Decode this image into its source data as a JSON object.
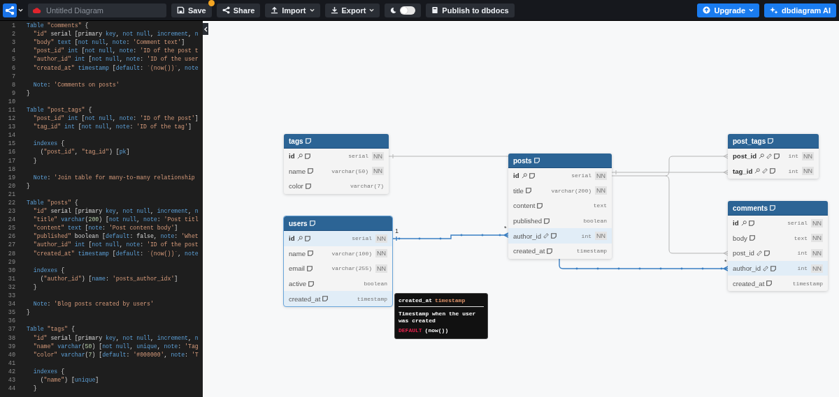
{
  "top_bar": {
    "title_field": {
      "value": "Untitled Diagram"
    },
    "buttons": [
      {
        "kind": "save",
        "label": "Save",
        "unsaved": true
      },
      {
        "kind": "share",
        "label": "Share"
      },
      {
        "kind": "import",
        "label": "Import",
        "dropdown": true
      },
      {
        "kind": "export",
        "label": "Export",
        "dropdown": true
      },
      {
        "kind": "theme",
        "on": false
      },
      {
        "kind": "publish",
        "label": "Publish to dbdocs"
      }
    ],
    "right_buttons": [
      {
        "kind": "upgrade",
        "label": "Upgrade",
        "dropdown": true
      },
      {
        "kind": "ai",
        "label": "dbdiagram AI"
      }
    ]
  },
  "editor": {
    "lines": [
      {
        "n": "1",
        "code": [
          {
            "kind": "kw",
            "text": "Table "
          },
          {
            "kind": "str",
            "text": "\"comments\""
          },
          {
            "kind": "plain",
            "text": " {"
          }
        ]
      },
      {
        "n": "2",
        "code": [
          {
            "kind": "str",
            "text": "  \"id\""
          },
          {
            "kind": "plain",
            "text": " serial [primary "
          },
          {
            "kind": "kw",
            "text": "key"
          },
          {
            "kind": "plain",
            "text": ", "
          },
          {
            "kind": "kw",
            "text": "not null"
          },
          {
            "kind": "plain",
            "text": ", "
          },
          {
            "kind": "kw",
            "text": "increment"
          },
          {
            "kind": "plain",
            "text": ", "
          },
          {
            "kind": "kw",
            "text": "n"
          }
        ]
      },
      {
        "n": "3",
        "code": [
          {
            "kind": "str",
            "text": "  \"body\""
          },
          {
            "kind": "kw",
            "text": " text"
          },
          {
            "kind": "plain",
            "text": " ["
          },
          {
            "kind": "kw",
            "text": "not null"
          },
          {
            "kind": "plain",
            "text": ", "
          },
          {
            "kind": "kw",
            "text": "note"
          },
          {
            "kind": "plain",
            "text": ": "
          },
          {
            "kind": "str",
            "text": "'Comment text'"
          },
          {
            "kind": "plain",
            "text": "]"
          }
        ]
      },
      {
        "n": "4",
        "code": [
          {
            "kind": "str",
            "text": "  \"post_id\""
          },
          {
            "kind": "kw",
            "text": " int"
          },
          {
            "kind": "plain",
            "text": " ["
          },
          {
            "kind": "kw",
            "text": "not null"
          },
          {
            "kind": "plain",
            "text": ", "
          },
          {
            "kind": "kw",
            "text": "note"
          },
          {
            "kind": "plain",
            "text": ": "
          },
          {
            "kind": "str",
            "text": "'ID of the post t"
          }
        ]
      },
      {
        "n": "5",
        "code": [
          {
            "kind": "str",
            "text": "  \"author_id\""
          },
          {
            "kind": "kw",
            "text": " int"
          },
          {
            "kind": "plain",
            "text": " ["
          },
          {
            "kind": "kw",
            "text": "not null"
          },
          {
            "kind": "plain",
            "text": ", "
          },
          {
            "kind": "kw",
            "text": "note"
          },
          {
            "kind": "plain",
            "text": ": "
          },
          {
            "kind": "str",
            "text": "'ID of the user"
          }
        ]
      },
      {
        "n": "6",
        "code": [
          {
            "kind": "str",
            "text": "  \"created_at\""
          },
          {
            "kind": "kw",
            "text": " timestamp"
          },
          {
            "kind": "plain",
            "text": " ["
          },
          {
            "kind": "kw",
            "text": "default"
          },
          {
            "kind": "plain",
            "text": ": "
          },
          {
            "kind": "str",
            "text": "`(now())`"
          },
          {
            "kind": "plain",
            "text": ", "
          },
          {
            "kind": "kw",
            "text": "note"
          }
        ]
      },
      {
        "n": "7"
      },
      {
        "n": "8",
        "code": [
          {
            "kind": "kw",
            "text": "  Note"
          },
          {
            "kind": "plain",
            "text": ": "
          },
          {
            "kind": "str",
            "text": "'Comments on posts'"
          }
        ]
      },
      {
        "n": "9",
        "code": [
          {
            "kind": "plain",
            "text": "}"
          }
        ]
      },
      {
        "n": "10"
      },
      {
        "n": "11",
        "code": [
          {
            "kind": "kw",
            "text": "Table "
          },
          {
            "kind": "str",
            "text": "\"post_tags\""
          },
          {
            "kind": "plain",
            "text": " {"
          }
        ]
      },
      {
        "n": "12",
        "code": [
          {
            "kind": "str",
            "text": "  \"post_id\""
          },
          {
            "kind": "kw",
            "text": " int"
          },
          {
            "kind": "plain",
            "text": " ["
          },
          {
            "kind": "kw",
            "text": "not null"
          },
          {
            "kind": "plain",
            "text": ", "
          },
          {
            "kind": "kw",
            "text": "note"
          },
          {
            "kind": "plain",
            "text": ": "
          },
          {
            "kind": "str",
            "text": "'ID of the post'"
          },
          {
            "kind": "plain",
            "text": "]"
          }
        ]
      },
      {
        "n": "13",
        "code": [
          {
            "kind": "str",
            "text": "  \"tag_id\""
          },
          {
            "kind": "kw",
            "text": " int"
          },
          {
            "kind": "plain",
            "text": " ["
          },
          {
            "kind": "kw",
            "text": "not null"
          },
          {
            "kind": "plain",
            "text": ", "
          },
          {
            "kind": "kw",
            "text": "note"
          },
          {
            "kind": "plain",
            "text": ": "
          },
          {
            "kind": "str",
            "text": "'ID of the tag'"
          },
          {
            "kind": "plain",
            "text": "]"
          }
        ]
      },
      {
        "n": "14"
      },
      {
        "n": "15",
        "code": [
          {
            "kind": "kw",
            "text": "  indexes"
          },
          {
            "kind": "plain",
            "text": " {"
          }
        ]
      },
      {
        "n": "16",
        "code": [
          {
            "kind": "plain",
            "text": "    ("
          },
          {
            "kind": "str",
            "text": "\"post_id\""
          },
          {
            "kind": "plain",
            "text": ", "
          },
          {
            "kind": "str",
            "text": "\"tag_id\""
          },
          {
            "kind": "plain",
            "text": ") ["
          },
          {
            "kind": "kw",
            "text": "pk"
          },
          {
            "kind": "plain",
            "text": "]"
          }
        ]
      },
      {
        "n": "17",
        "code": [
          {
            "kind": "plain",
            "text": "  }"
          }
        ]
      },
      {
        "n": "18"
      },
      {
        "n": "19",
        "code": [
          {
            "kind": "kw",
            "text": "  Note"
          },
          {
            "kind": "plain",
            "text": ": "
          },
          {
            "kind": "str",
            "text": "'Join table for many-to-many relationship"
          }
        ]
      },
      {
        "n": "20",
        "code": [
          {
            "kind": "plain",
            "text": "}"
          }
        ]
      },
      {
        "n": "21"
      },
      {
        "n": "22",
        "code": [
          {
            "kind": "kw",
            "text": "Table "
          },
          {
            "kind": "str",
            "text": "\"posts\""
          },
          {
            "kind": "plain",
            "text": " {"
          }
        ]
      },
      {
        "n": "23",
        "code": [
          {
            "kind": "str",
            "text": "  \"id\""
          },
          {
            "kind": "plain",
            "text": " serial [primary "
          },
          {
            "kind": "kw",
            "text": "key"
          },
          {
            "kind": "plain",
            "text": ", "
          },
          {
            "kind": "kw",
            "text": "not null"
          },
          {
            "kind": "plain",
            "text": ", "
          },
          {
            "kind": "kw",
            "text": "increment"
          },
          {
            "kind": "plain",
            "text": ", "
          },
          {
            "kind": "kw",
            "text": "n"
          }
        ]
      },
      {
        "n": "24",
        "code": [
          {
            "kind": "str",
            "text": "  \"title\""
          },
          {
            "kind": "kw",
            "text": " varchar"
          },
          {
            "kind": "plain",
            "text": "("
          },
          {
            "kind": "num",
            "text": "200"
          },
          {
            "kind": "plain",
            "text": ") ["
          },
          {
            "kind": "kw",
            "text": "not null"
          },
          {
            "kind": "plain",
            "text": ", "
          },
          {
            "kind": "kw",
            "text": "note"
          },
          {
            "kind": "plain",
            "text": ": "
          },
          {
            "kind": "str",
            "text": "'Post titl"
          }
        ]
      },
      {
        "n": "25",
        "code": [
          {
            "kind": "str",
            "text": "  \"content\""
          },
          {
            "kind": "kw",
            "text": " text"
          },
          {
            "kind": "plain",
            "text": " ["
          },
          {
            "kind": "kw",
            "text": "note"
          },
          {
            "kind": "plain",
            "text": ": "
          },
          {
            "kind": "str",
            "text": "'Post content body'"
          },
          {
            "kind": "plain",
            "text": "]"
          }
        ]
      },
      {
        "n": "26",
        "code": [
          {
            "kind": "str",
            "text": "  \"published\""
          },
          {
            "kind": "plain",
            "text": " boolean ["
          },
          {
            "kind": "kw",
            "text": "default"
          },
          {
            "kind": "plain",
            "text": ": false, "
          },
          {
            "kind": "kw",
            "text": "note"
          },
          {
            "kind": "plain",
            "text": ": "
          },
          {
            "kind": "str",
            "text": "'Whet"
          }
        ]
      },
      {
        "n": "27",
        "code": [
          {
            "kind": "str",
            "text": "  \"author_id\""
          },
          {
            "kind": "kw",
            "text": " int"
          },
          {
            "kind": "plain",
            "text": " ["
          },
          {
            "kind": "kw",
            "text": "not null"
          },
          {
            "kind": "plain",
            "text": ", "
          },
          {
            "kind": "kw",
            "text": "note"
          },
          {
            "kind": "plain",
            "text": ": "
          },
          {
            "kind": "str",
            "text": "'ID of the post"
          }
        ]
      },
      {
        "n": "28",
        "code": [
          {
            "kind": "str",
            "text": "  \"created_at\""
          },
          {
            "kind": "kw",
            "text": " timestamp"
          },
          {
            "kind": "plain",
            "text": " ["
          },
          {
            "kind": "kw",
            "text": "default"
          },
          {
            "kind": "plain",
            "text": ": "
          },
          {
            "kind": "str",
            "text": "`(now())`"
          },
          {
            "kind": "plain",
            "text": ", "
          },
          {
            "kind": "kw",
            "text": "note"
          }
        ]
      },
      {
        "n": "29"
      },
      {
        "n": "30",
        "code": [
          {
            "kind": "kw",
            "text": "  indexes"
          },
          {
            "kind": "plain",
            "text": " {"
          }
        ]
      },
      {
        "n": "31",
        "code": [
          {
            "kind": "plain",
            "text": "    ("
          },
          {
            "kind": "str",
            "text": "\"author_id\""
          },
          {
            "kind": "plain",
            "text": ") ["
          },
          {
            "kind": "kw",
            "text": "name"
          },
          {
            "kind": "plain",
            "text": ": "
          },
          {
            "kind": "str",
            "text": "'posts_author_idx'"
          },
          {
            "kind": "plain",
            "text": "]"
          }
        ]
      },
      {
        "n": "32",
        "code": [
          {
            "kind": "plain",
            "text": "  }"
          }
        ]
      },
      {
        "n": "33"
      },
      {
        "n": "34",
        "code": [
          {
            "kind": "kw",
            "text": "  Note"
          },
          {
            "kind": "plain",
            "text": ": "
          },
          {
            "kind": "str",
            "text": "'Blog posts created by users'"
          }
        ]
      },
      {
        "n": "35",
        "code": [
          {
            "kind": "plain",
            "text": "}"
          }
        ]
      },
      {
        "n": "36"
      },
      {
        "n": "37",
        "code": [
          {
            "kind": "kw",
            "text": "Table "
          },
          {
            "kind": "str",
            "text": "\"tags\""
          },
          {
            "kind": "plain",
            "text": " {"
          }
        ]
      },
      {
        "n": "38",
        "code": [
          {
            "kind": "str",
            "text": "  \"id\""
          },
          {
            "kind": "plain",
            "text": " serial [primary "
          },
          {
            "kind": "kw",
            "text": "key"
          },
          {
            "kind": "plain",
            "text": ", "
          },
          {
            "kind": "kw",
            "text": "not null"
          },
          {
            "kind": "plain",
            "text": ", "
          },
          {
            "kind": "kw",
            "text": "increment"
          },
          {
            "kind": "plain",
            "text": ", "
          },
          {
            "kind": "kw",
            "text": "n"
          }
        ]
      },
      {
        "n": "39",
        "code": [
          {
            "kind": "str",
            "text": "  \"name\""
          },
          {
            "kind": "kw",
            "text": " varchar"
          },
          {
            "kind": "plain",
            "text": "("
          },
          {
            "kind": "num",
            "text": "50"
          },
          {
            "kind": "plain",
            "text": ") ["
          },
          {
            "kind": "kw",
            "text": "not null"
          },
          {
            "kind": "plain",
            "text": ", "
          },
          {
            "kind": "kw",
            "text": "unique"
          },
          {
            "kind": "plain",
            "text": ", "
          },
          {
            "kind": "kw",
            "text": "note"
          },
          {
            "kind": "plain",
            "text": ": "
          },
          {
            "kind": "str",
            "text": "'Tag"
          }
        ]
      },
      {
        "n": "40",
        "code": [
          {
            "kind": "str",
            "text": "  \"color\""
          },
          {
            "kind": "kw",
            "text": " varchar"
          },
          {
            "kind": "plain",
            "text": "("
          },
          {
            "kind": "num",
            "text": "7"
          },
          {
            "kind": "plain",
            "text": ") ["
          },
          {
            "kind": "kw",
            "text": "default"
          },
          {
            "kind": "plain",
            "text": ": "
          },
          {
            "kind": "str",
            "text": "'#000000'"
          },
          {
            "kind": "plain",
            "text": ", "
          },
          {
            "kind": "kw",
            "text": "note"
          },
          {
            "kind": "plain",
            "text": ": "
          },
          {
            "kind": "str",
            "text": "'T"
          }
        ]
      },
      {
        "n": "41"
      },
      {
        "n": "42",
        "code": [
          {
            "kind": "kw",
            "text": "  indexes"
          },
          {
            "kind": "plain",
            "text": " {"
          }
        ]
      },
      {
        "n": "43",
        "code": [
          {
            "kind": "plain",
            "text": "    ("
          },
          {
            "kind": "str",
            "text": "\"name\""
          },
          {
            "kind": "plain",
            "text": ") ["
          },
          {
            "kind": "kw",
            "text": "unique"
          },
          {
            "kind": "plain",
            "text": "]"
          }
        ]
      },
      {
        "n": "44",
        "code": [
          {
            "kind": "plain",
            "text": "  }"
          }
        ]
      }
    ]
  },
  "diagram": {
    "tables": [
      {
        "name": "tags",
        "selected": false,
        "fields": [
          {
            "name": "id",
            "pk": true,
            "fk": false,
            "type": "serial",
            "badge": "NN",
            "highlighted": false
          },
          {
            "name": "name",
            "pk": false,
            "fk": false,
            "type": "varchar(50)",
            "badge": "NN",
            "highlighted": false
          },
          {
            "name": "color",
            "pk": false,
            "fk": false,
            "type": "varchar(7)",
            "highlighted": false
          }
        ]
      },
      {
        "name": "post_tags",
        "selected": false,
        "fields": [
          {
            "name": "post_id",
            "pk": true,
            "fk": true,
            "type": "int",
            "badge": "NN",
            "highlighted": false
          },
          {
            "name": "tag_id",
            "pk": true,
            "fk": true,
            "type": "int",
            "badge": "NN",
            "highlighted": false
          }
        ]
      },
      {
        "name": "posts",
        "selected": false,
        "fields": [
          {
            "name": "id",
            "pk": true,
            "fk": false,
            "type": "serial",
            "badge": "NN",
            "highlighted": false
          },
          {
            "name": "title",
            "pk": false,
            "fk": false,
            "type": "varchar(200)",
            "badge": "NN",
            "highlighted": false
          },
          {
            "name": "content",
            "pk": false,
            "fk": false,
            "type": "text",
            "highlighted": false
          },
          {
            "name": "published",
            "pk": false,
            "fk": false,
            "type": "boolean",
            "highlighted": false
          },
          {
            "name": "author_id",
            "pk": false,
            "fk": true,
            "type": "int",
            "badge": "NN",
            "highlighted": true
          },
          {
            "name": "created_at",
            "pk": false,
            "fk": false,
            "type": "timestamp",
            "highlighted": false
          }
        ]
      },
      {
        "name": "comments",
        "selected": false,
        "fields": [
          {
            "name": "id",
            "pk": true,
            "fk": false,
            "type": "serial",
            "badge": "NN",
            "highlighted": false
          },
          {
            "name": "body",
            "pk": false,
            "fk": false,
            "type": "text",
            "badge": "NN",
            "highlighted": false
          },
          {
            "name": "post_id",
            "pk": false,
            "fk": true,
            "type": "int",
            "badge": "NN",
            "highlighted": false
          },
          {
            "name": "author_id",
            "pk": false,
            "fk": true,
            "type": "int",
            "badge": "NN",
            "highlighted": true
          },
          {
            "name": "created_at",
            "pk": false,
            "fk": false,
            "type": "timestamp",
            "highlighted": false
          }
        ]
      },
      {
        "name": "users",
        "selected": true,
        "fields": [
          {
            "name": "id",
            "pk": true,
            "fk": false,
            "type": "serial",
            "badge": "NN",
            "highlighted": true
          },
          {
            "name": "name",
            "pk": false,
            "fk": false,
            "type": "varchar(100)",
            "badge": "NN",
            "highlighted": false
          },
          {
            "name": "email",
            "pk": false,
            "fk": false,
            "type": "varchar(255)",
            "badge": "NN",
            "highlighted": false
          },
          {
            "name": "active",
            "pk": false,
            "fk": false,
            "type": "boolean",
            "highlighted": false
          },
          {
            "name": "created_at",
            "pk": false,
            "fk": false,
            "type": "timestamp",
            "highlighted": true
          }
        ]
      }
    ],
    "relationships": [
      {
        "highlighted": false
      },
      {
        "highlighted": false
      },
      {
        "highlighted": false
      },
      {
        "highlighted": false
      },
      {
        "highlighted": true,
        "start_label": "1",
        "end_label": "*"
      },
      {
        "highlighted": true,
        "end_label": "*"
      }
    ],
    "tooltip": {
      "field": "created_at",
      "type": "timestamp",
      "note": "Timestamp when the user was created",
      "default_label": "DEFAULT",
      "default_value": "(now())"
    }
  }
}
